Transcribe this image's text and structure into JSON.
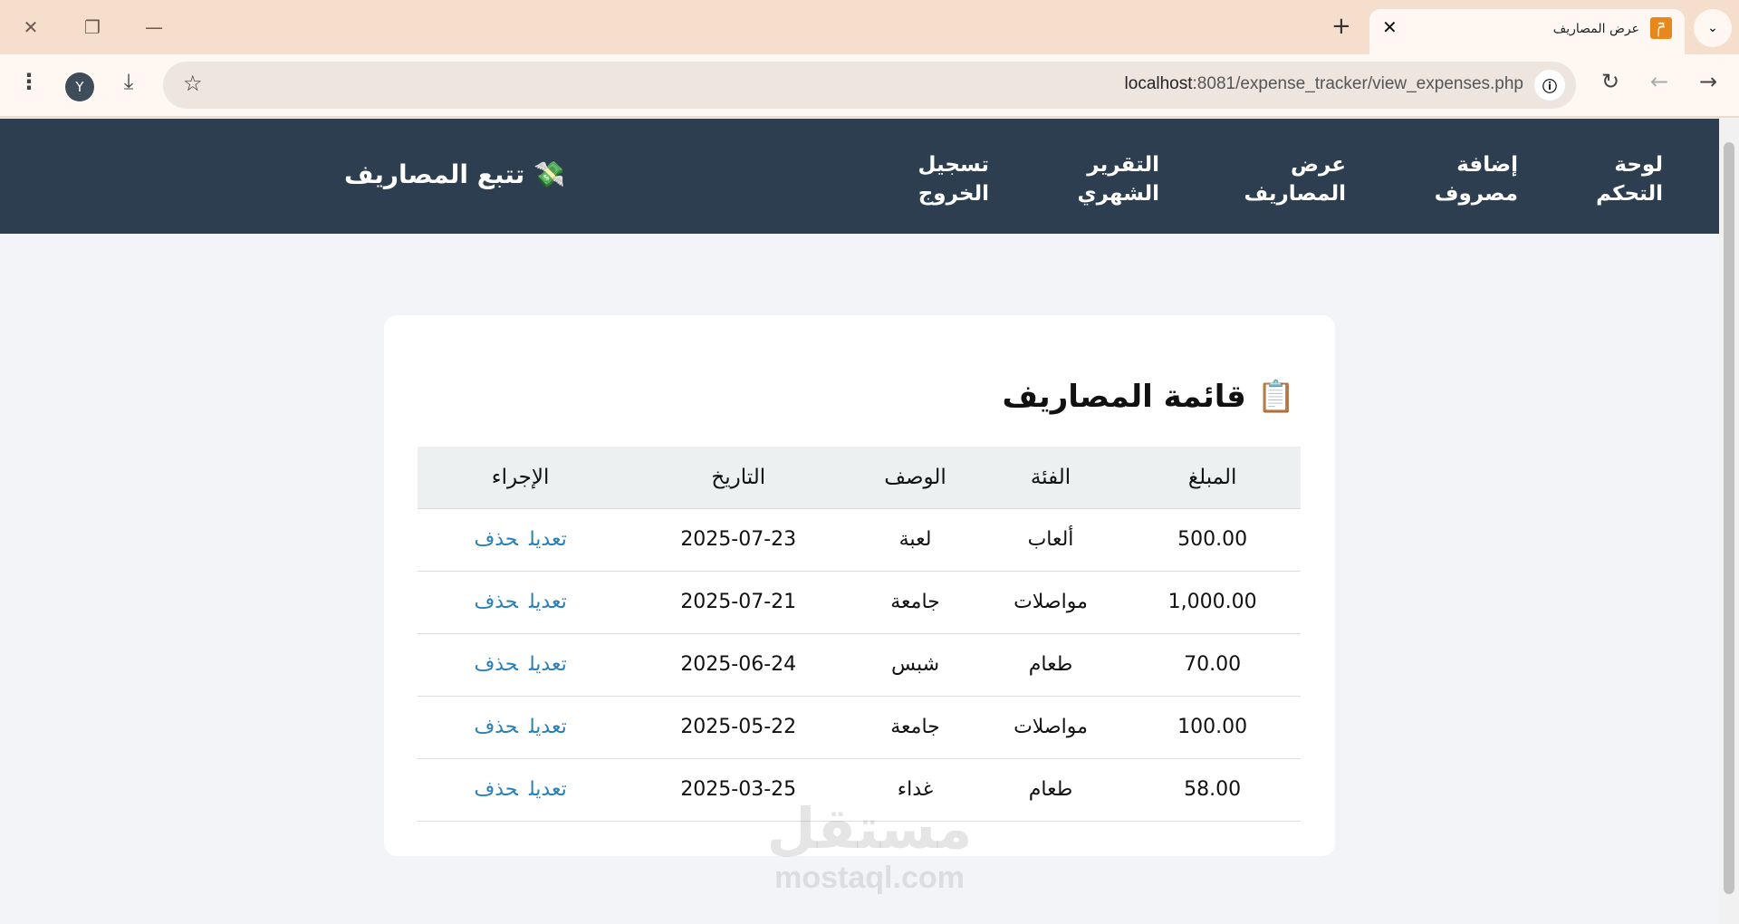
{
  "browser": {
    "tab_title": "عرض المصاريف",
    "url_host": "localhost",
    "url_path": ":8081/expense_tracker/view_expenses.php",
    "avatar_letter": "Y"
  },
  "nav": {
    "brand": "تتبع المصاريف",
    "brand_icon": "💸",
    "items": [
      {
        "label": "لوحة التحكم"
      },
      {
        "label": "إضافة مصروف"
      },
      {
        "label": "عرض المصاريف"
      },
      {
        "label": "التقرير الشهري"
      },
      {
        "label": "تسجيل الخروج"
      }
    ]
  },
  "main": {
    "title": "قائمة المصاريف",
    "title_icon": "📋",
    "columns": [
      "المبلغ",
      "الفئة",
      "الوصف",
      "التاريخ",
      "الإجراء"
    ],
    "rows": [
      {
        "amount": "500.00",
        "category": "ألعاب",
        "description": "لعبة",
        "date": "2025-07-23"
      },
      {
        "amount": "1,000.00",
        "category": "مواصلات",
        "description": "جامعة",
        "date": "2025-07-21"
      },
      {
        "amount": "70.00",
        "category": "طعام",
        "description": "شبس",
        "date": "2025-06-24"
      },
      {
        "amount": "100.00",
        "category": "مواصلات",
        "description": "جامعة",
        "date": "2025-05-22"
      },
      {
        "amount": "58.00",
        "category": "طعام",
        "description": "غداء",
        "date": "2025-03-25"
      }
    ],
    "edit_label": "تعديل",
    "delete_label": "حذف"
  },
  "watermark": {
    "ar": "مستقل",
    "en": "mostaql.com"
  }
}
